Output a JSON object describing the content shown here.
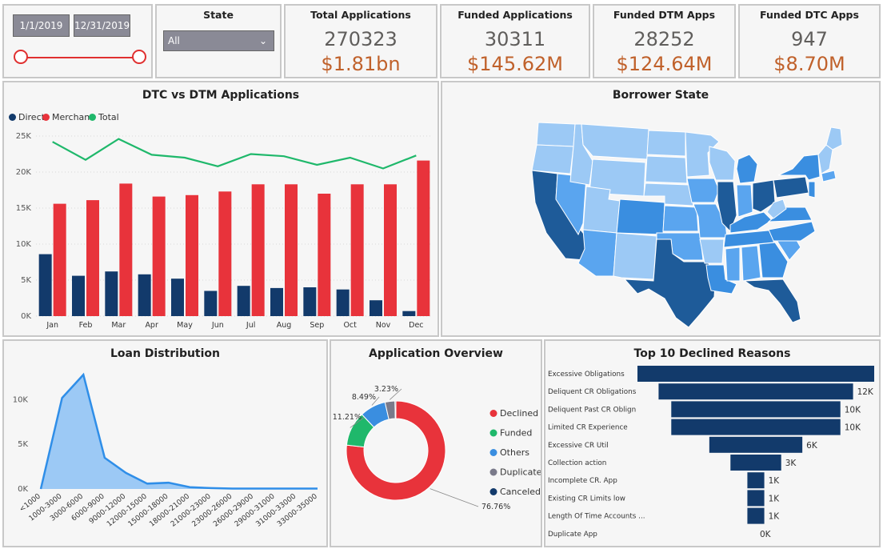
{
  "date_filter": {
    "start": "1/1/2019",
    "end": "12/31/2019"
  },
  "state_filter": {
    "label": "State",
    "selected": "All"
  },
  "kpis": [
    {
      "title": "Total Applications",
      "count": "270323",
      "amount": "$1.81bn"
    },
    {
      "title": "Funded Applications",
      "count": "30311",
      "amount": "$145.62M"
    },
    {
      "title": "Funded DTM Apps",
      "count": "28252",
      "amount": "$124.64M"
    },
    {
      "title": "Funded DTC Apps",
      "count": "947",
      "amount": "$8.70M"
    }
  ],
  "colors": {
    "direct": "#123a6b",
    "merchant": "#e8333b",
    "total": "#1fb86b",
    "area": "#9cc9f5",
    "area_line": "#2f8ee8",
    "declined": "#e8333b",
    "funded": "#1fb86b",
    "others": "#3a8ee0",
    "duplicate": "#7a7a8a",
    "canceled": "#123a6b",
    "funnel": "#123a6b",
    "kpi_amount": "#c0612b"
  },
  "dtc_dtm": {
    "title": "DTC vs DTM Applications",
    "chart_data": {
      "type": "bar",
      "categories": [
        "Jan",
        "Feb",
        "Mar",
        "Apr",
        "May",
        "Jun",
        "Jul",
        "Aug",
        "Sep",
        "Oct",
        "Nov",
        "Dec"
      ],
      "series": [
        {
          "name": "Direct",
          "type": "bar",
          "values": [
            8600,
            5600,
            6200,
            5800,
            5200,
            3500,
            4200,
            3900,
            4000,
            3700,
            2200,
            700
          ]
        },
        {
          "name": "Merchant",
          "type": "bar",
          "values": [
            15600,
            16100,
            18400,
            16600,
            16800,
            17300,
            18300,
            18300,
            17000,
            18300,
            18300,
            21600
          ]
        },
        {
          "name": "Total",
          "type": "line",
          "values": [
            24200,
            21700,
            24600,
            22400,
            22000,
            20800,
            22500,
            22200,
            21000,
            22000,
            20500,
            22300
          ]
        }
      ],
      "ylim": [
        0,
        25000
      ],
      "yticks": [
        "0K",
        "5K",
        "10K",
        "15K",
        "20K",
        "25K"
      ],
      "xlabel": "",
      "ylabel": "",
      "legend": "top-left",
      "grid": true
    }
  },
  "borrower_state": {
    "title": "Borrower State"
  },
  "loan_distribution": {
    "title": "Loan Distribution",
    "chart_data": {
      "type": "area",
      "categories": [
        "<1000",
        "1000-3000",
        "3000-6000",
        "6000-9000",
        "9000-12000",
        "12000-15000",
        "15000-18000",
        "18000-21000",
        "21000-23000",
        "23000-26000",
        "26000-29000",
        "29000-31000",
        "31000-33000",
        "33000-35000"
      ],
      "values": [
        0,
        10200,
        12800,
        3500,
        1800,
        600,
        700,
        200,
        100,
        50,
        50,
        50,
        50,
        50
      ],
      "ylim": [
        0,
        13000
      ],
      "yticks": [
        "0K",
        "5K",
        "10K"
      ],
      "xlabel": "",
      "ylabel": "",
      "grid": false
    }
  },
  "application_overview": {
    "title": "Application Overview",
    "chart_data": {
      "type": "pie",
      "labels": [
        "Declined",
        "Funded",
        "Others",
        "Duplicate",
        "Canceled"
      ],
      "values": [
        76.76,
        11.21,
        8.49,
        3.23,
        0.31
      ],
      "data_labels": [
        "76.76%",
        "11.21%",
        "8.49%",
        "3.23%",
        ""
      ],
      "legend": "right"
    }
  },
  "declined_reasons": {
    "title": "Top 10 Declined Reasons",
    "chart_data": {
      "type": "bar",
      "categories": [
        "Excessive Obligations",
        "Deliquent CR Obligations",
        "Deliquent Past CR Oblign",
        "Limited CR Experience",
        "Excessive CR Util",
        "Collection action",
        "Incomplete CR. App",
        "Existing CR Limits low",
        "Length Of Time Accounts ...",
        "Duplicate App"
      ],
      "values": [
        14000,
        11500,
        10000,
        10000,
        5500,
        3000,
        1000,
        1000,
        1000,
        0
      ],
      "data_labels": [
        "",
        "12K",
        "10K",
        "10K",
        "6K",
        "3K",
        "1K",
        "1K",
        "1K",
        "0K"
      ]
    }
  }
}
